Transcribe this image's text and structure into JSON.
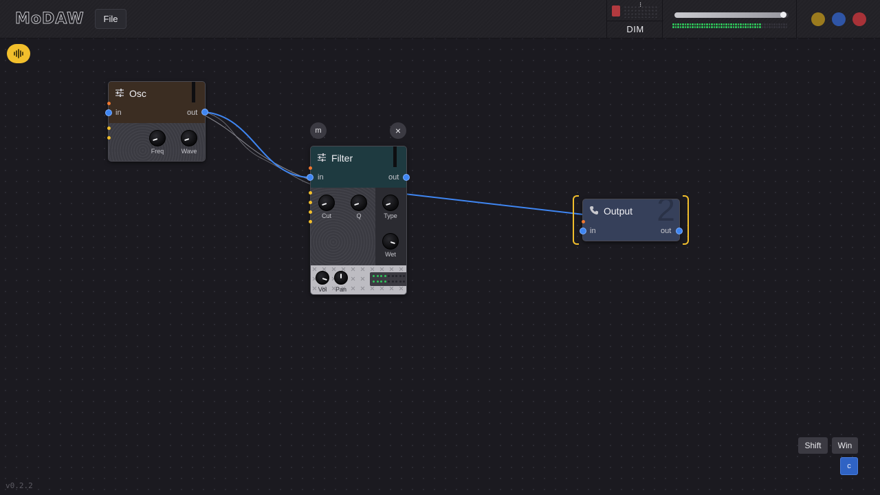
{
  "app": {
    "logo_text": "MoDAW",
    "version": "v0.2.2"
  },
  "menu": {
    "file_label": "File"
  },
  "dim": {
    "label": "DIM",
    "dots": "⁝"
  },
  "volume": {
    "level": 0.95,
    "meter_level": 0.78
  },
  "window_controls": [
    {
      "name": "minimize",
      "color": "#9b7b1e"
    },
    {
      "name": "maximize",
      "color": "#2f55a6"
    },
    {
      "name": "close",
      "color": "#a83238"
    }
  ],
  "colors": {
    "accent": "#f2bf2c",
    "link": "#3f86f2",
    "osc_header": "#3b2d22",
    "filter_header": "#1e3a40",
    "output_body": "#36405a",
    "port_orange": "#f07830",
    "port_yellow": "#f2bf2c"
  },
  "nodes": {
    "osc": {
      "title": "Osc",
      "icon": "sliders-icon",
      "in_label": "in",
      "out_label": "out",
      "knobs": [
        {
          "label": "Freq",
          "value": 0.1
        },
        {
          "label": "Wave",
          "value": 0.1
        }
      ]
    },
    "filter": {
      "title": "Filter",
      "icon": "sliders-icon",
      "in_label": "in",
      "out_label": "out",
      "mute_label": "m",
      "close_label": "×",
      "knobs": [
        {
          "label": "Cut",
          "value": 0.1
        },
        {
          "label": "Q",
          "value": 0.1
        }
      ],
      "side_knobs": [
        {
          "label": "Type",
          "value": 0.1
        },
        {
          "label": "Wet",
          "value": 0.9
        }
      ],
      "mixer_knobs": [
        {
          "label": "Vol",
          "value": 0.9
        },
        {
          "label": "Pan",
          "value": 0.5
        }
      ]
    },
    "output": {
      "title": "Output",
      "icon": "phone-icon",
      "badge": "2",
      "in_label": "in",
      "out_label": "out"
    }
  },
  "keys": {
    "shift": "Shift",
    "win": "Win",
    "c": "c"
  }
}
